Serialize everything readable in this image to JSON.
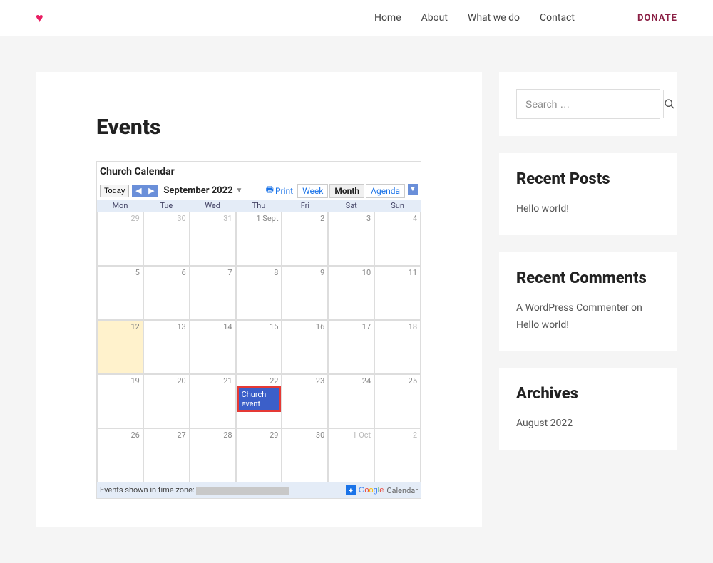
{
  "nav": {
    "items": [
      "Home",
      "About",
      "What we do",
      "Contact"
    ],
    "donate": "DONATE"
  },
  "page": {
    "title": "Events"
  },
  "calendar": {
    "title": "Church Calendar",
    "today_label": "Today",
    "month_label": "September 2022",
    "print_label": "Print",
    "views": {
      "week": "Week",
      "month": "Month",
      "agenda": "Agenda",
      "active": "month"
    },
    "day_headers": [
      "Mon",
      "Tue",
      "Wed",
      "Thu",
      "Fri",
      "Sat",
      "Sun"
    ],
    "rows": [
      [
        {
          "n": "29",
          "other": true
        },
        {
          "n": "30",
          "other": true
        },
        {
          "n": "31",
          "other": true
        },
        {
          "n": "1 Sept"
        },
        {
          "n": "2"
        },
        {
          "n": "3"
        },
        {
          "n": "4"
        }
      ],
      [
        {
          "n": "5"
        },
        {
          "n": "6"
        },
        {
          "n": "7"
        },
        {
          "n": "8"
        },
        {
          "n": "9"
        },
        {
          "n": "10"
        },
        {
          "n": "11"
        }
      ],
      [
        {
          "n": "12",
          "today": true
        },
        {
          "n": "13"
        },
        {
          "n": "14"
        },
        {
          "n": "15"
        },
        {
          "n": "16"
        },
        {
          "n": "17"
        },
        {
          "n": "18"
        }
      ],
      [
        {
          "n": "19"
        },
        {
          "n": "20"
        },
        {
          "n": "21"
        },
        {
          "n": "22",
          "event": "Church event"
        },
        {
          "n": "23"
        },
        {
          "n": "24"
        },
        {
          "n": "25"
        }
      ],
      [
        {
          "n": "26"
        },
        {
          "n": "27"
        },
        {
          "n": "28"
        },
        {
          "n": "29"
        },
        {
          "n": "30"
        },
        {
          "n": "1 Oct",
          "other": true
        },
        {
          "n": "2",
          "other": true
        }
      ]
    ],
    "timezone_label": "Events shown in time zone:",
    "badge_label": "Calendar"
  },
  "sidebar": {
    "search_placeholder": "Search …",
    "recent_posts": {
      "title": "Recent Posts",
      "items": [
        "Hello world!"
      ]
    },
    "recent_comments": {
      "title": "Recent Comments",
      "items": [
        "A WordPress Commenter on Hello world!"
      ]
    },
    "archives": {
      "title": "Archives",
      "items": [
        "August 2022"
      ]
    }
  }
}
